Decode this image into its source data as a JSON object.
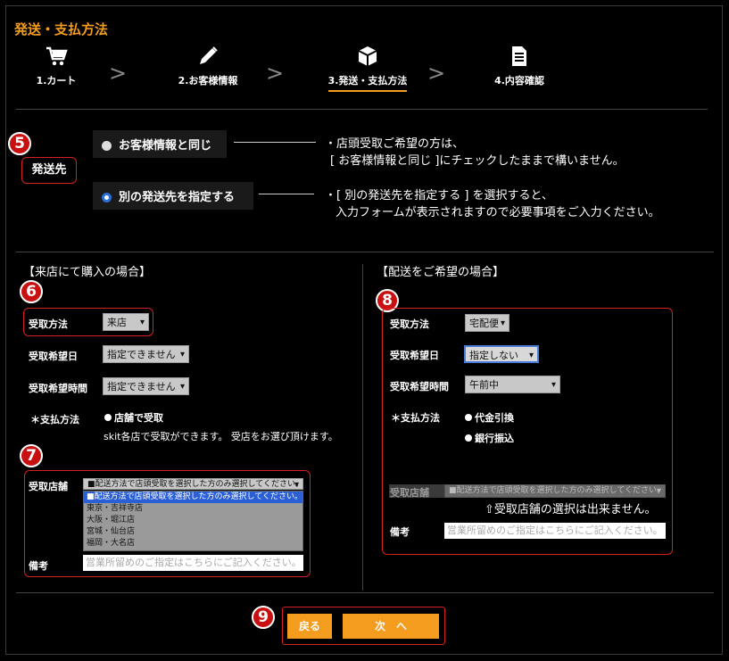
{
  "page_title": "発送・支払方法",
  "steps": [
    {
      "label": "1.カート",
      "icon": "cart-icon"
    },
    {
      "label": "2.お客様情報",
      "icon": "pen-icon"
    },
    {
      "label": "3.発送・支払方法",
      "icon": "box-icon"
    },
    {
      "label": "4.内容確認",
      "icon": "document-icon"
    }
  ],
  "step_separator": ">",
  "badges": [
    "5",
    "6",
    "7",
    "8",
    "9"
  ],
  "shipping": {
    "label": "発送先",
    "option_same": "お客様情報と同じ",
    "option_other": "別の発送先を指定する",
    "note_same_1": "・店頭受取ご希望の方は、",
    "note_same_2": "[ お客様情報と同じ ]にチェックしたままで構いません。",
    "note_other_1": "・[ 別の発送先を指定する ] を選択すると、",
    "note_other_2": "入力フォームが表示されますので必要事項をご入力ください。"
  },
  "store": {
    "title": "【来店にて購入の場合】",
    "method_label": "受取方法",
    "method_value": "来店",
    "date_label": "受取希望日",
    "date_value": "指定できません",
    "time_label": "受取希望時間",
    "time_value": "指定できません",
    "payment_label": "＊支払方法",
    "payment_option": "店舗で受取",
    "payment_note": "skit各店で受取ができます。 受店をお選び頂けます。",
    "shop_label": "受取店舗",
    "shop_value": "■配送方法で店頭受取を選択した方のみ選択してください。",
    "shop_options": [
      "■配送方法で店頭受取を選択した方のみ選択してください。",
      "東京・吉祥寺店",
      "大阪・堀江店",
      "宮城・仙台店",
      "福岡・大名店"
    ],
    "remarks_label": "備考",
    "remarks_placeholder": "営業所留めのご指定はこちらにご記入ください。"
  },
  "delivery": {
    "title": "【配送をご希望の場合】",
    "method_label": "受取方法",
    "method_value": "宅配便",
    "date_label": "受取希望日",
    "date_value": "指定しない",
    "time_label": "受取希望時間",
    "time_value": "午前中",
    "payment_label": "＊支払方法",
    "payment_cod": "代金引換",
    "payment_bank": "銀行振込",
    "shop_label": "受取店舗",
    "shop_value": "■配送方法で店頭受取を選択した方のみ選択してください。",
    "shop_note": "⇧受取店舗の選択は出来ません。",
    "remarks_label": "備考",
    "remarks_placeholder": "営業所留めのご指定はこちらにご記入ください。"
  },
  "buttons": {
    "back": "戻る",
    "next": "次　へ"
  },
  "colors": {
    "accent": "#f39c1e",
    "highlight": "#d62020",
    "badge": "#c81010"
  }
}
